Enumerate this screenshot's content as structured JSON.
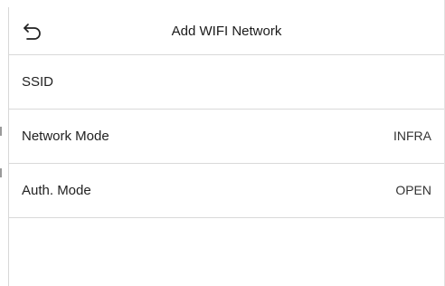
{
  "header": {
    "title": "Add WIFI Network",
    "back_icon": "undo-arrow-icon"
  },
  "rows": [
    {
      "label": "SSID",
      "value": ""
    },
    {
      "label": "Network Mode",
      "value": "INFRA"
    },
    {
      "label": "Auth. Mode",
      "value": "OPEN"
    }
  ],
  "colors": {
    "background": "#ffffff",
    "divider": "#d9d9d9",
    "text": "#1a1a1a"
  }
}
